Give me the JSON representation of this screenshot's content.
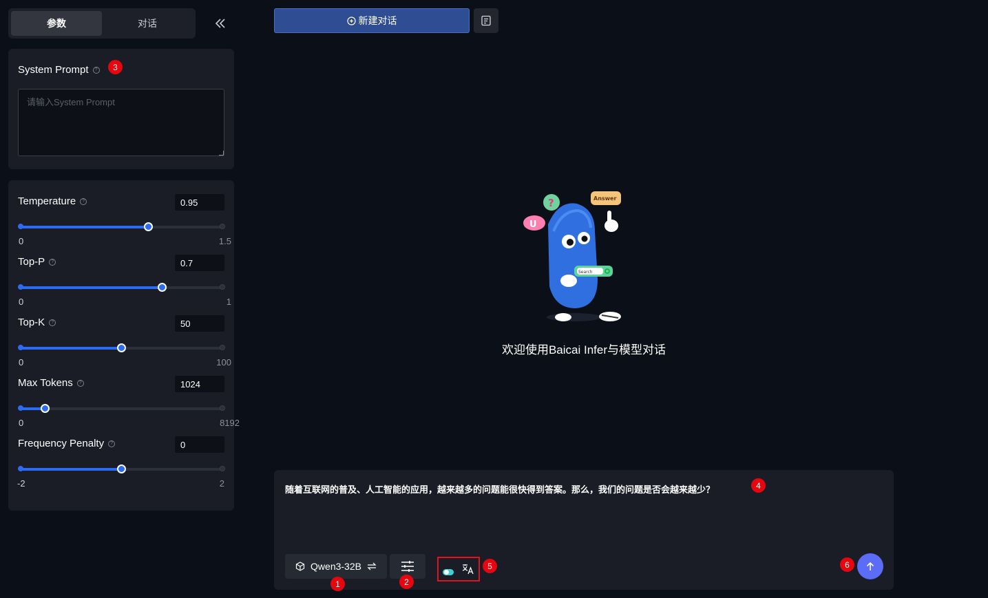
{
  "tabs": {
    "params": "参数",
    "chat": "对话"
  },
  "system_prompt": {
    "label": "System Prompt",
    "placeholder": "请输入System Prompt"
  },
  "params": [
    {
      "label": "Temperature",
      "value": "0.95",
      "min": "0",
      "max": "1.5",
      "fraction": 0.633
    },
    {
      "label": "Top-P",
      "value": "0.7",
      "min": "0",
      "max": "1",
      "fraction": 0.7
    },
    {
      "label": "Top-K",
      "value": "50",
      "min": "0",
      "max": "100",
      "fraction": 0.5
    },
    {
      "label": "Max Tokens",
      "value": "1024",
      "min": "0",
      "max": "8192",
      "fraction": 0.125
    },
    {
      "label": "Frequency Penalty",
      "value": "0",
      "min": "-2",
      "max": "2",
      "fraction": 0.5
    }
  ],
  "toolbar": {
    "new_chat": "新建对话"
  },
  "hero": {
    "welcome": "欢迎使用Baicai Infer与模型对话",
    "bubble_answer": "Answer",
    "bubble_question": "?",
    "bubble_u": "U",
    "search_label": "Search"
  },
  "input": {
    "text": "随着互联网的普及、人工智能的应用，越来越多的问题能很快得到答案。那么，我们的问题是否会越来越少？",
    "model": "Qwen3-32B"
  },
  "markers": [
    "1",
    "2",
    "3",
    "4",
    "5",
    "6"
  ],
  "colors": {
    "accent": "#2d6cf0",
    "send": "#5b6cf7",
    "marker": "#e6060f",
    "background": "#0b0f17"
  }
}
